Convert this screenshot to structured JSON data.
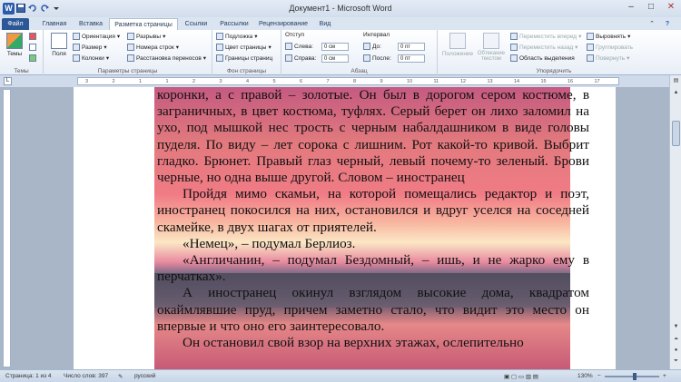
{
  "window": {
    "title": "Документ1 - Microsoft Word",
    "logo": "W",
    "controls": {
      "minimize": "–",
      "maximize": "□",
      "close": "✕"
    }
  },
  "qat": {
    "icons": [
      "save-icon",
      "undo-icon",
      "redo-icon",
      "customize-icon"
    ]
  },
  "tabs": [
    "Файл",
    "Главная",
    "Вставка",
    "Разметка страницы",
    "Ссылки",
    "Рассылки",
    "Рецензирование",
    "Вид"
  ],
  "active_tab": "Разметка страницы",
  "ribbon": {
    "themes": {
      "button": "Темы",
      "group": "Темы"
    },
    "page_setup": {
      "fields_btn": "Поля",
      "orientation": "Ориентация",
      "size": "Размер",
      "columns": "Колонки",
      "breaks": "Разрывы",
      "line_numbers": "Номера строк",
      "hyphenation": "Расстановка переносов",
      "group": "Параметры страницы"
    },
    "page_bg": {
      "watermark": "Подложка",
      "page_color": "Цвет страницы",
      "page_borders": "Границы страниц",
      "group": "Фон страницы"
    },
    "paragraph": {
      "indent_title": "Отступ",
      "left": "Слева:",
      "left_val": "0 см",
      "right": "Справа:",
      "right_val": "0 см",
      "spacing_title": "Интервал",
      "before": "До:",
      "before_val": "0 пт",
      "after": "После:",
      "after_val": "0 пт",
      "group": "Абзац"
    },
    "arrange": {
      "position": "Положение",
      "wrap": "Обтекание текстом",
      "bring_forward": "Переместить вперед",
      "send_backward": "Переместить назад",
      "selection_pane": "Область выделения",
      "align": "Выровнять",
      "group_btn": "Группировать",
      "rotate": "Повернуть",
      "group": "Упорядочить"
    }
  },
  "ruler": {
    "numbers": [
      "3",
      "2",
      "1",
      "1",
      "2",
      "3",
      "4",
      "5",
      "6",
      "7",
      "8",
      "9",
      "10",
      "11",
      "12",
      "13",
      "14",
      "15",
      "16",
      "17"
    ]
  },
  "document": {
    "paragraphs": [
      "коронки, а с правой – золотые. Он был в дорогом сером костюме, в заграничных, в цвет костюма, туфлях. Серый берет он лихо заломил на ухо, под мышкой нес трость с черным набалдашником в виде головы пуделя. По виду – лет сорока с лишним. Рот какой-то кривой. Выбрит гладко. Брюнет. Правый глаз черный, левый почему-то зеленый. Брови черные, но одна выше другой. Словом – иностранец",
      "Пройдя мимо скамьи, на которой помещались редактор и поэт, иностранец покосился на них, остановился и вдруг уселся на соседней скамейке, в двух шагах от приятелей.",
      "«Немец», – подумал Берлиоз.",
      "«Англичанин, – подумал Бездомный, – ишь, и не жарко ему в перчатках».",
      "А иностранец окинул взглядом высокие дома, квадратом окаймлявшие пруд, причем заметно стало, что видит это место он впервые и что оно его заинтересовало.",
      "Он остановил свой взор на верхних этажах, ослепительно"
    ]
  },
  "status": {
    "page": "Страница: 1 из 4",
    "words": "Число слов: 397",
    "language": "русский",
    "zoom": "130%",
    "zoom_fraction": 0.56
  }
}
